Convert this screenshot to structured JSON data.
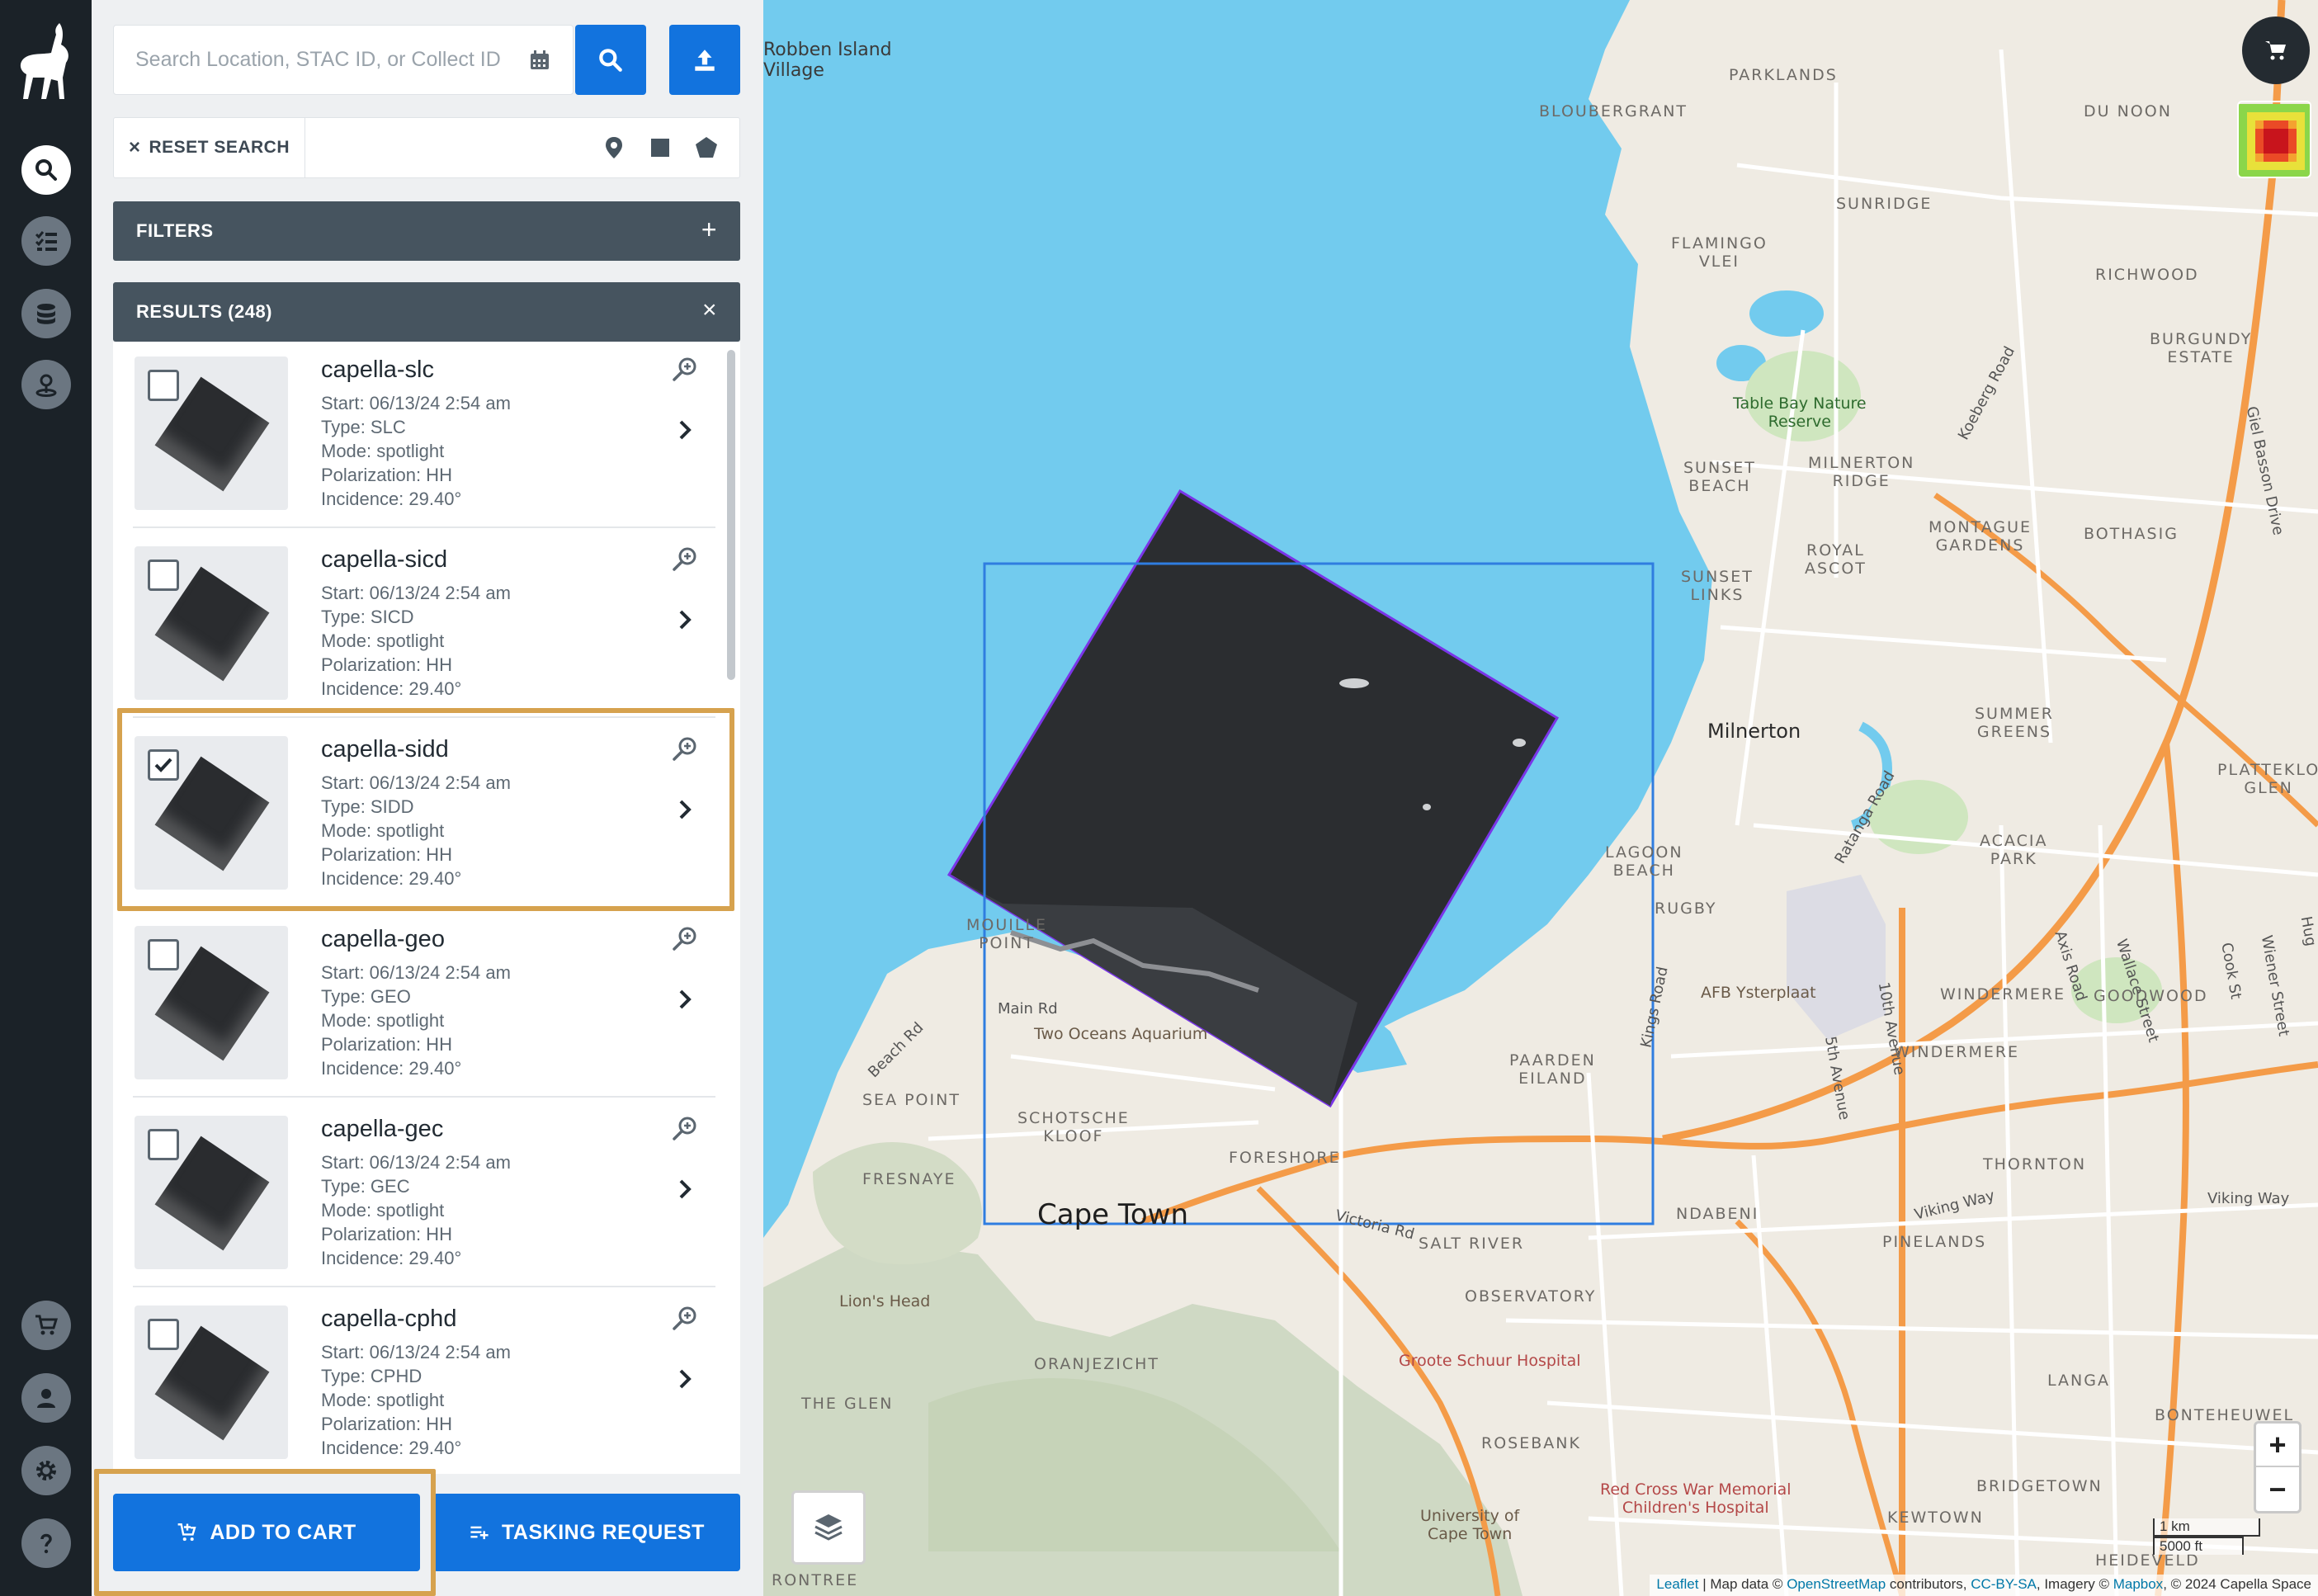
{
  "search": {
    "placeholder": "Search Location, STAC ID, or Collect ID"
  },
  "toolbar": {
    "reset_label": "RESET SEARCH"
  },
  "filters": {
    "label": "FILTERS"
  },
  "results": {
    "label": "RESULTS (248)",
    "items": [
      {
        "name": "capella-slc",
        "start": "Start: 06/13/24 2:54 am",
        "type": "Type: SLC",
        "mode": "Mode: spotlight",
        "polarization": "Polarization: HH",
        "incidence": "Incidence: 29.40°",
        "checked": false
      },
      {
        "name": "capella-sicd",
        "start": "Start: 06/13/24 2:54 am",
        "type": "Type: SICD",
        "mode": "Mode: spotlight",
        "polarization": "Polarization: HH",
        "incidence": "Incidence: 29.40°",
        "checked": false
      },
      {
        "name": "capella-sidd",
        "start": "Start: 06/13/24 2:54 am",
        "type": "Type: SIDD",
        "mode": "Mode: spotlight",
        "polarization": "Polarization: HH",
        "incidence": "Incidence: 29.40°",
        "checked": true
      },
      {
        "name": "capella-geo",
        "start": "Start: 06/13/24 2:54 am",
        "type": "Type: GEO",
        "mode": "Mode: spotlight",
        "polarization": "Polarization: HH",
        "incidence": "Incidence: 29.40°",
        "checked": false
      },
      {
        "name": "capella-gec",
        "start": "Start: 06/13/24 2:54 am",
        "type": "Type: GEC",
        "mode": "Mode: spotlight",
        "polarization": "Polarization: HH",
        "incidence": "Incidence: 29.40°",
        "checked": false
      },
      {
        "name": "capella-cphd",
        "start": "Start: 06/13/24 2:54 am",
        "type": "Type: CPHD",
        "mode": "Mode: spotlight",
        "polarization": "Polarization: HH",
        "incidence": "Incidence: 29.40°",
        "checked": false
      }
    ]
  },
  "actions": {
    "add_to_cart": "ADD TO CART",
    "tasking_request": "TASKING REQUEST"
  },
  "map": {
    "labels": {
      "robben": "Robben Island\nVillage",
      "parklands": "PARKLANDS",
      "bloubergrant": "BLOUBERGRANT",
      "du_noon": "DU NOON",
      "sunridge": "SUNRIDGE",
      "flamingo": "FLAMINGO\nVLEI",
      "richwood": "RICHWOOD",
      "burgundy": "BURGUNDY\nESTATE",
      "table_bay": "Table Bay Nature\nReserve",
      "koeberg": "Koeberg Road",
      "giel": "Giel Basson Drive",
      "sunset_beach": "SUNSET\nBEACH",
      "milnerton_ridge": "MILNERTON\nRIDGE",
      "montague": "MONTAGUE\nGARDENS",
      "bothasig": "BOTHASIG",
      "royal_ascot": "ROYAL\nASCOT",
      "sunset_links": "SUNSET\nLINKS",
      "milnerton": "Milnerton",
      "summer_greens": "SUMMER\nGREENS",
      "plattekloof": "PLATTEKLO\nGLEN",
      "ratanga": "Ratanga Road",
      "lagoon_beach": "LAGOON\nBEACH",
      "acacia": "ACACIA\nPARK",
      "rugby": "RUGBY",
      "mouille": "MOUILLE\nPOINT",
      "main_rd": "Main Rd",
      "aquarium": "Two Oceans Aquarium",
      "beach_rd": "Beach Rd",
      "sea_point": "SEA POINT",
      "schotsche": "SCHOTSCHE\nKLOOF",
      "foreshore": "FORESHORE",
      "paarden": "PAARDEN\nEILAND",
      "kings_rd": "Kings Road",
      "ysterplaat": "AFB Ysterplaat",
      "tenth_ave": "10th Avenue",
      "fifth_ave": "5th Avenue",
      "windermere": "WINDERMERE",
      "goodwood": "GOODWOOD",
      "axis_rd": "Axis Road",
      "wallace": "Wallace Street",
      "cook_st": "Cook St",
      "wiener": "Wiener Street",
      "fresnaye": "FRESNAYE",
      "cape_town": "Cape Town",
      "victoria": "Victoria Rd",
      "salt_river": "SALT RIVER",
      "ndabeni": "NDABENI",
      "thornton": "THORNTON",
      "viking": "Viking Way",
      "viking2": "Viking Way",
      "pinelands": "PINELANDS",
      "lions_head": "Lion's Head",
      "observatory": "OBSERVATORY",
      "groote": "Groote Schuur Hospital",
      "oranjezicht": "ORANJEZICHT",
      "the_glen": "THE GLEN",
      "langa": "LANGA",
      "bonteheuwel": "BONTEHEUWEL",
      "rosebank": "ROSEBANK",
      "red_cross": "Red Cross War Memorial\nChildren's Hospital",
      "university": "University of\nCape Town",
      "bridgetown": "BRIDGETOWN",
      "kewtown": "KEWTOWN",
      "heideveld": "HEIDEVELD",
      "rontree": "RONTREE",
      "hug": "Hug"
    },
    "zoom_in": "+",
    "zoom_out": "−",
    "scale_km": "1 km",
    "scale_ft": "5000 ft",
    "attribution": {
      "leaflet": "Leaflet",
      "map_data": " | Map data © ",
      "osm": "OpenStreetMap",
      "contrib": " contributors, ",
      "ccbysa": "CC-BY-SA",
      "imagery": ", Imagery © ",
      "mapbox": "Mapbox",
      "capella": ", © 2024 Capella Space"
    }
  },
  "colors": {
    "primary_blue": "#1273de",
    "highlight_gold": "#d6a24e",
    "rail_bg": "#1b2228",
    "section_bar": "#46545f",
    "water": "#72cbee",
    "footprint_outline": "#7a35e8",
    "aoi_box": "#2f7de0"
  }
}
